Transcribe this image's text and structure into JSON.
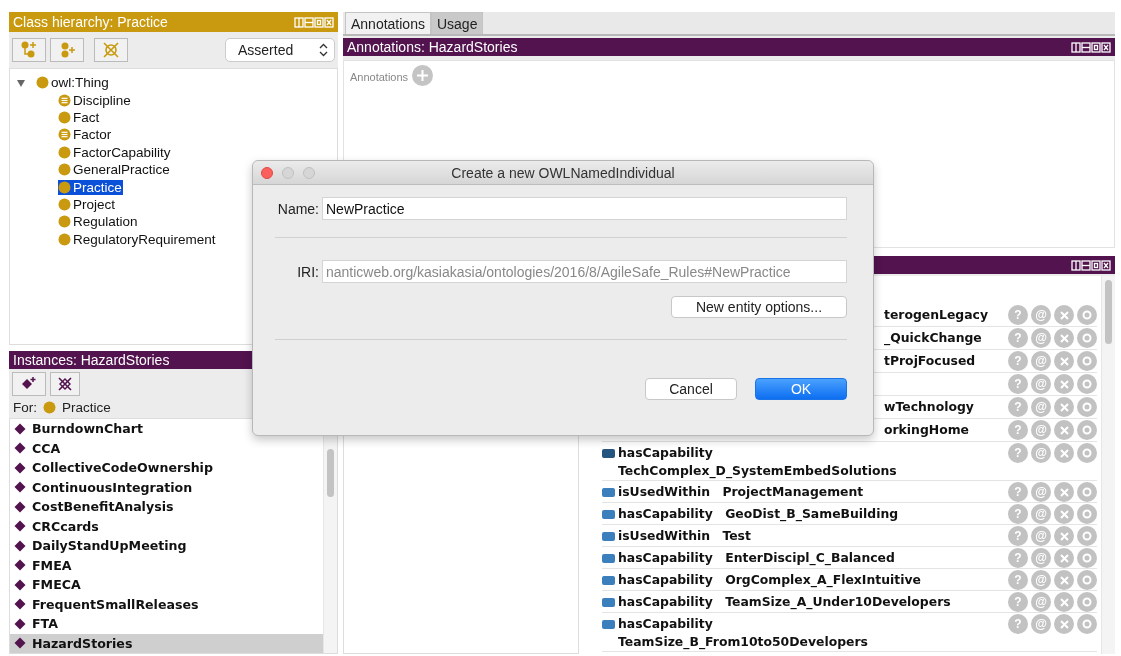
{
  "class_hierarchy": {
    "title": "Class hierarchy: Practice",
    "mode": "Asserted",
    "tree": {
      "label": "owl:Thing",
      "kind": "primitive",
      "expanded": true,
      "selected": false,
      "children": [
        {
          "label": "Discipline",
          "kind": "defined",
          "selected": false
        },
        {
          "label": "Fact",
          "kind": "primitive",
          "selected": false
        },
        {
          "label": "Factor",
          "kind": "defined",
          "selected": false
        },
        {
          "label": "FactorCapability",
          "kind": "primitive",
          "selected": false
        },
        {
          "label": "GeneralPractice",
          "kind": "primitive",
          "selected": false
        },
        {
          "label": "Practice",
          "kind": "primitive",
          "selected": true
        },
        {
          "label": "Project",
          "kind": "primitive",
          "selected": false
        },
        {
          "label": "Regulation",
          "kind": "primitive",
          "selected": false
        },
        {
          "label": "RegulatoryRequirement",
          "kind": "primitive",
          "selected": false
        }
      ]
    }
  },
  "tabs": [
    {
      "label": "Annotations",
      "selected": true
    },
    {
      "label": "Usage",
      "selected": false
    }
  ],
  "annotations": {
    "title": "Annotations: HazardStories",
    "label": "Annotations"
  },
  "instances": {
    "title": "Instances: HazardStories",
    "for_label": "For:",
    "for_class": "Practice",
    "items": [
      {
        "label": "BurndownChart",
        "selected": false
      },
      {
        "label": "CCA",
        "selected": false
      },
      {
        "label": "CollectiveCodeOwnership",
        "selected": false
      },
      {
        "label": "ContinuousIntegration",
        "selected": false
      },
      {
        "label": "CostBenefitAnalysis",
        "selected": false
      },
      {
        "label": "CRCcards",
        "selected": false
      },
      {
        "label": "DailyStandUpMeeting",
        "selected": false
      },
      {
        "label": "FMEA",
        "selected": false
      },
      {
        "label": "FMECA",
        "selected": false
      },
      {
        "label": "FrequentSmallReleases",
        "selected": false
      },
      {
        "label": "FTA",
        "selected": false
      },
      {
        "label": "HazardStories",
        "selected": true
      }
    ]
  },
  "property_assertions": {
    "rows": [
      {
        "kind": "covered",
        "text": "terogenLegacy",
        "marks": [
          "?",
          "@"
        ]
      },
      {
        "kind": "covered",
        "text": "_QuickChange",
        "marks": [
          "?",
          "@"
        ]
      },
      {
        "kind": "covered",
        "text": "tProjFocused",
        "marks": [
          "?",
          "@"
        ]
      },
      {
        "kind": "covered",
        "marks": [
          "?",
          "@"
        ]
      },
      {
        "kind": "covered",
        "text": "wTechnology",
        "marks": [
          "?",
          "@"
        ]
      },
      {
        "kind": "covered",
        "text": "orkingHome",
        "marks": [
          "?",
          "@"
        ]
      },
      {
        "kind": "full",
        "property": "hasCapability",
        "value": "TechComplex_D_SystemEmbedSolutions",
        "wrapped": true,
        "marks": [
          "?",
          "@"
        ]
      },
      {
        "kind": "full",
        "property": "isUsedWithin",
        "value": "ProjectManagement",
        "wrapped": false,
        "marks": [
          "?",
          "@"
        ]
      },
      {
        "kind": "full",
        "property": "hasCapability",
        "value": "GeoDist_B_SameBuilding",
        "wrapped": false,
        "marks": [
          "?",
          "@"
        ]
      },
      {
        "kind": "full",
        "property": "isUsedWithin",
        "value": "Test",
        "wrapped": false,
        "marks": [
          "?",
          "@"
        ]
      },
      {
        "kind": "full",
        "property": "hasCapability",
        "value": "EnterDiscipl_C_Balanced",
        "wrapped": false,
        "marks": [
          "?",
          "@"
        ]
      },
      {
        "kind": "full",
        "property": "hasCapability",
        "value": "OrgComplex_A_FlexIntuitive",
        "wrapped": false,
        "marks": [
          "?",
          "@"
        ]
      },
      {
        "kind": "full",
        "property": "hasCapability",
        "value": "TeamSize_A_Under10Developers",
        "wrapped": false,
        "marks": [
          "?",
          "@"
        ]
      },
      {
        "kind": "full",
        "property": "hasCapability",
        "value": "TeamSize_B_From10to50Developers",
        "wrapped": true,
        "marks": [
          "?",
          "@"
        ]
      }
    ]
  },
  "dialog": {
    "title": "Create a new OWLNamedIndividual",
    "name_label": "Name:",
    "name_value": "NewPractice",
    "iri_label": "IRI:",
    "iri_value": "nanticweb.org/kasiakasia/ontologies/2016/8/AgileSafe_Rules#NewPractice",
    "options_button": "New entity options...",
    "buttons": [
      {
        "label": "Cancel",
        "kind": "secondary"
      },
      {
        "label": "OK",
        "kind": "primary"
      }
    ]
  }
}
